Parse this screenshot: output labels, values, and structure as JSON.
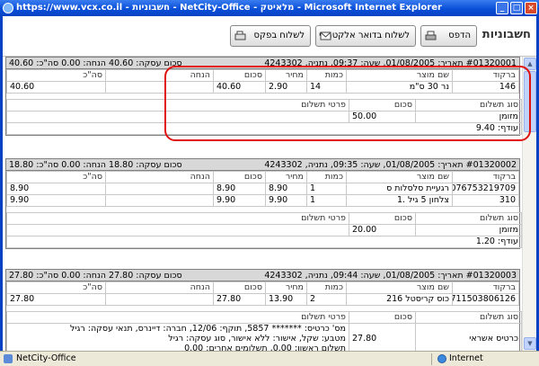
{
  "window": {
    "title": "https://www.vcx.co.il - חשבוניות - NetCity-Office - מלאיטק - Microsoft Internet Explorer"
  },
  "toolbar": {
    "app_title": "חשבוניות",
    "print_label": "הדפס",
    "email_label": "לשלוח בדואר אלקטרוני",
    "fax_label": "לשלוח בפקס"
  },
  "invoices": [
    {
      "header_right": "#01320001 תאריך: 01/08/2005, שעה: 09:37, נתניה, 4243302",
      "header_left": "סכום עסקה: 40.60 הנחה: 0.00 סה\"כ: 40.60",
      "col_headers": [
        "ברקוד",
        "שם מוצר",
        "כמות",
        "מחיר",
        "סכום",
        "הנחה",
        "סה\"כ"
      ],
      "rows": [
        [
          "146",
          "נר 30 ס\"מ",
          "14",
          "2.90",
          "40.60",
          "",
          "40.60"
        ]
      ],
      "pay_headers": [
        "סוג תשלום",
        "סכום",
        "פרטי תשלום"
      ],
      "payments": [
        [
          "מזומן",
          "50.00",
          ""
        ]
      ],
      "change": "עודף: 9.40"
    },
    {
      "header_right": "#01320002 תאריך: 01/08/2005, שעה: 09:35, נתניה, 4243302",
      "header_left": "סכום עסקה: 18.80 הנחה: 0.00 סה\"כ: 18.80",
      "col_headers": [
        "ברקוד",
        "שם מוצר",
        "כמות",
        "מחיר",
        "סכום",
        "הנחה",
        "סה\"כ"
      ],
      "rows": [
        [
          "076753219709",
          "רגעיית סלסלות ס",
          "1",
          "8.90",
          "8.90",
          "",
          "8.90"
        ],
        [
          "310",
          "צלחון 5 גיל .1",
          "1",
          "9.90",
          "9.90",
          "",
          "9.90"
        ]
      ],
      "pay_headers": [
        "סוג תשלום",
        "סכום",
        "פרטי תשלום"
      ],
      "payments": [
        [
          "מזומן",
          "20.00",
          ""
        ]
      ],
      "change": "עודף: 1.20"
    },
    {
      "header_right": "#01320003 תאריך: 01/08/2005, שעה: 09:44, נתניה, 4243302",
      "header_left": "סכום עסקה: 27.80 הנחה: 0.00 סה\"כ: 27.80",
      "col_headers": [
        "ברקוד",
        "שם מוצר",
        "כמות",
        "מחיר",
        "סכום",
        "הנחה",
        "סה\"כ"
      ],
      "rows": [
        [
          "8711503806126",
          "כוס קריסטל 216",
          "2",
          "13.90",
          "27.80",
          "",
          "27.80"
        ]
      ],
      "pay_headers": [
        "סוג תשלום",
        "סכום",
        "פרטי תשלום"
      ],
      "payments": [
        [
          "כרטיס אשראי",
          "27.80",
          "מס' כרטיס: ******* 5857, תוקף: 12/06, חברה: דיינרס, תנאי עסקה: רגיל\nמטבע: שקל, אישור: ללא אישור, סוג עסקה: רגיל\nתשלום ראשון: 0.00, תשלומים אחרים: 0.00"
        ]
      ]
    }
  ],
  "status": {
    "left": "NetCity-Office",
    "zone": "Internet"
  },
  "colors": {
    "title_bar": "#0a4fd8",
    "highlight": "#e01010",
    "header_bg": "#d8d8d8"
  }
}
